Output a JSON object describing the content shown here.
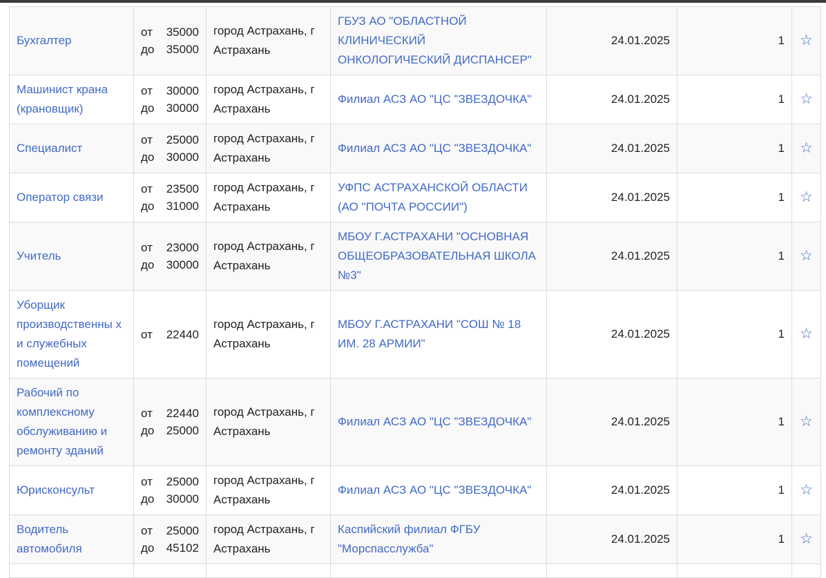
{
  "rows": [
    {
      "title": "Бухгалтер",
      "salary": [
        {
          "word": "от",
          "value": "35000"
        },
        {
          "word": "до",
          "value": "35000"
        }
      ],
      "location": "город Астрахань, г Астрахань",
      "employer": "ГБУЗ АО \"ОБЛАСТНОЙ КЛИНИЧЕСКИЙ ОНКОЛОГИЧЕСКИЙ ДИСПАНСЕР\"",
      "date": "24.01.2025",
      "count": "1",
      "star": "☆"
    },
    {
      "title": "Машинист крана (крановщик)",
      "salary": [
        {
          "word": "от",
          "value": "30000"
        },
        {
          "word": "до",
          "value": "30000"
        }
      ],
      "location": "город Астрахань, г Астрахань",
      "employer": "Филиал АСЗ АО \"ЦС \"ЗВЕЗДОЧКА\"",
      "date": "24.01.2025",
      "count": "1",
      "star": "☆"
    },
    {
      "title": "Специалист",
      "salary": [
        {
          "word": "от",
          "value": "25000"
        },
        {
          "word": "до",
          "value": "30000"
        }
      ],
      "location": "город Астрахань, г Астрахань",
      "employer": "Филиал АСЗ АО \"ЦС \"ЗВЕЗДОЧКА\"",
      "date": "24.01.2025",
      "count": "1",
      "star": "☆"
    },
    {
      "title": "Оператор связи",
      "salary": [
        {
          "word": "от",
          "value": "23500"
        },
        {
          "word": "до",
          "value": "31000"
        }
      ],
      "location": "город Астрахань, г Астрахань",
      "employer": "УФПС АСТРАХАНСКОЙ ОБЛАСТИ (АО \"ПОЧТА РОССИИ\")",
      "date": "24.01.2025",
      "count": "1",
      "star": "☆"
    },
    {
      "title": "Учитель",
      "salary": [
        {
          "word": "от",
          "value": "23000"
        },
        {
          "word": "до",
          "value": "30000"
        }
      ],
      "location": "город Астрахань, г Астрахань",
      "employer": "МБОУ Г.АСТРАХАНИ \"ОСНОВНАЯ ОБЩЕОБРАЗОВАТЕЛЬНАЯ ШКОЛА №3\"",
      "date": "24.01.2025",
      "count": "1",
      "star": "☆"
    },
    {
      "title": "Уборщик производственны х и служебных помещений",
      "salary": [
        {
          "word": "от",
          "value": "22440"
        }
      ],
      "location": "город Астрахань, г Астрахань",
      "employer": "МБОУ Г.АСТРАХАНИ \"СОШ № 18 ИМ. 28 АРМИИ\"",
      "date": "24.01.2025",
      "count": "1",
      "star": "☆"
    },
    {
      "title": "Рабочий по комплексному обслуживанию и ремонту зданий",
      "salary": [
        {
          "word": "от",
          "value": "22440"
        },
        {
          "word": "до",
          "value": "25000"
        }
      ],
      "location": "город Астрахань, г Астрахань",
      "employer": "Филиал АСЗ АО \"ЦС \"ЗВЕЗДОЧКА\"",
      "date": "24.01.2025",
      "count": "1",
      "star": "☆"
    },
    {
      "title": "Юрисконсульт",
      "salary": [
        {
          "word": "от",
          "value": "25000"
        },
        {
          "word": "до",
          "value": "30000"
        }
      ],
      "location": "город Астрахань, г Астрахань",
      "employer": "Филиал АСЗ АО \"ЦС \"ЗВЕЗДОЧКА\"",
      "date": "24.01.2025",
      "count": "1",
      "star": "☆"
    },
    {
      "title": "Водитель автомобиля",
      "salary": [
        {
          "word": "от",
          "value": "25000"
        },
        {
          "word": "до",
          "value": "45102"
        }
      ],
      "location": "город Астрахань, г Астрахань",
      "employer": "Каспийский филиал ФГБУ \"Морспасслужба\"",
      "date": "24.01.2025",
      "count": "1",
      "star": "☆"
    }
  ]
}
